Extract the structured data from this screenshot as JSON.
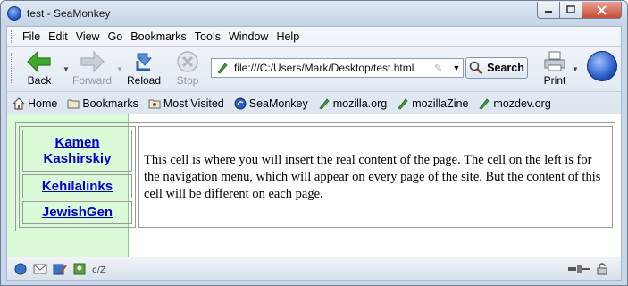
{
  "window": {
    "title": "test - SeaMonkey"
  },
  "menu": [
    "File",
    "Edit",
    "View",
    "Go",
    "Bookmarks",
    "Tools",
    "Window",
    "Help"
  ],
  "nav": {
    "back": "Back",
    "forward": "Forward",
    "reload": "Reload",
    "stop": "Stop",
    "print": "Print",
    "search": "Search"
  },
  "url": {
    "value": "file:///C:/Users/Mark/Desktop/test.html"
  },
  "bookmarks": [
    "Home",
    "Bookmarks",
    "Most Visited",
    "SeaMonkey",
    "mozilla.org",
    "mozillaZine",
    "mozdev.org"
  ],
  "page": {
    "links": [
      "Kamen Kashirskiy",
      "Kehilalinks",
      "JewishGen"
    ],
    "content": "This cell is where you will insert the real content of the page. The cell on the left is for the navigation menu, which will appear on every page of the site. But the content of this cell will be different on each page."
  },
  "icons": {
    "back": "green-left-arrow-icon",
    "forward": "gray-right-arrow-icon",
    "reload": "reload-icon",
    "stop": "stop-icon",
    "print": "printer-icon",
    "logo": "seamonkey-logo-icon"
  },
  "colors": {
    "sidebar_bg": "#dbfbd8",
    "link": "#0000cc",
    "chrome": "#dde5ef"
  }
}
